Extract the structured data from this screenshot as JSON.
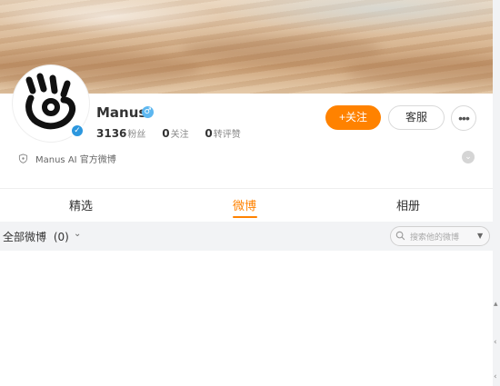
{
  "profile": {
    "name": "Manus",
    "gender": "male",
    "verified": true,
    "stats": [
      {
        "value": "3136",
        "label": "粉丝"
      },
      {
        "value": "0",
        "label": "关注"
      },
      {
        "value": "0",
        "label": "转评赞"
      }
    ],
    "description": "Manus AI 官方微博"
  },
  "actions": {
    "follow_label": "+关注",
    "service_label": "客服",
    "more_label": "•••"
  },
  "tabs": [
    {
      "label": "精选",
      "active": false
    },
    {
      "label": "微博",
      "active": true
    },
    {
      "label": "相册",
      "active": false
    }
  ],
  "filter": {
    "label": "全部微博",
    "count": "(0)"
  },
  "search": {
    "placeholder": "搜索他的微博"
  },
  "colors": {
    "accent": "#ff8200",
    "verify": "#2c97de",
    "gender": "#5db7f0"
  },
  "icons": [
    "shield-icon",
    "verified-badge-icon",
    "male-icon",
    "chevron-down-icon",
    "search-icon",
    "more-icon",
    "expand-icon"
  ]
}
